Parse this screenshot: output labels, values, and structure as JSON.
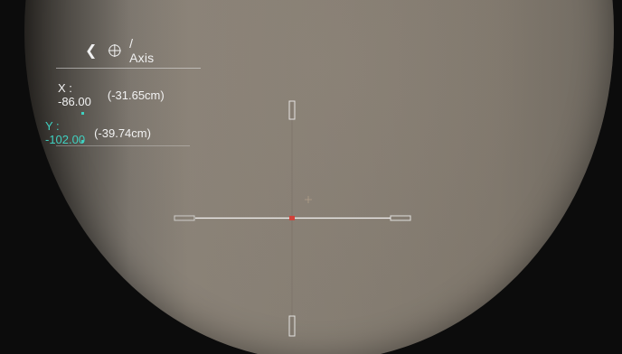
{
  "menu": {
    "title": "/ Axis",
    "back_icon": "chevron-left-icon",
    "mode_icon": "crosshair-icon",
    "x": {
      "label": "X : -86.00",
      "cm": "(-31.65cm)"
    },
    "y": {
      "label": "Y : -102.00",
      "cm": "(-39.74cm)"
    }
  },
  "colors": {
    "selected": "#3fd0c0",
    "text": "#f0f0f0",
    "reticle_center": "#d0423a"
  }
}
